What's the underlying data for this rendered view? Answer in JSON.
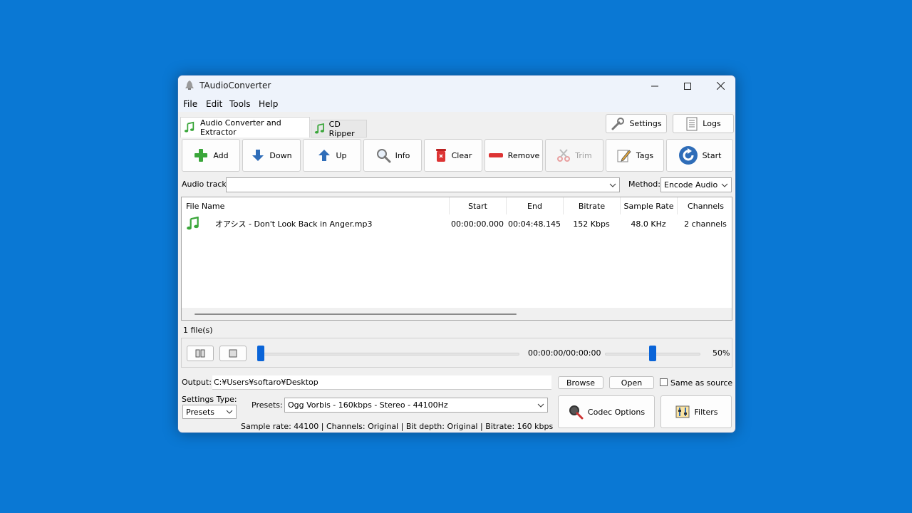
{
  "window": {
    "title": "TAudioConverter"
  },
  "menu": [
    "File",
    "Edit",
    "Tools",
    "Help"
  ],
  "tabs": [
    {
      "label": "Audio Converter and Extractor",
      "icon": "music-note-icon",
      "active": true
    },
    {
      "label": "CD Ripper",
      "icon": "music-note-icon",
      "active": false
    }
  ],
  "top_buttons": {
    "settings": "Settings",
    "logs": "Logs"
  },
  "toolbar": {
    "add": "Add",
    "down": "Down",
    "up": "Up",
    "info": "Info",
    "clear": "Clear",
    "remove": "Remove",
    "trim": "Trim",
    "tags": "Tags",
    "start": "Start"
  },
  "audio_track": {
    "label": "Audio track:",
    "value": ""
  },
  "method": {
    "label": "Method:",
    "value": "Encode Audio"
  },
  "file_list": {
    "columns": [
      "File Name",
      "Start",
      "End",
      "Bitrate",
      "Sample Rate",
      "Channels"
    ],
    "rows": [
      {
        "name": "オアシス - Don't Look Back in Anger.mp3",
        "start": "00:00:00.000",
        "end": "00:04:48.145",
        "bitrate": "152 Kbps",
        "sample_rate": "48.0 KHz",
        "channels": "2 channels"
      }
    ]
  },
  "file_count": "1 file(s)",
  "player": {
    "time": "00:00:00/00:00:00",
    "position": 0,
    "volume_percent": 50,
    "volume_label": "50%"
  },
  "output": {
    "label": "Output:",
    "path": "C:¥Users¥softaro¥Desktop",
    "browse": "Browse",
    "open": "Open",
    "same_as_source": "Same as source",
    "same_as_source_checked": false
  },
  "settings_type": {
    "label": "Settings Type:",
    "value": "Presets"
  },
  "presets": {
    "label": "Presets:",
    "value": "Ogg Vorbis - 160kbps - Stereo - 44100Hz"
  },
  "codec_options": "Codec Options",
  "filters": "Filters",
  "status": "Sample rate: 44100 | Channels: Original | Bit depth: Original | Bitrate: 160 kbps",
  "colors": {
    "desktop": "#0a78d4",
    "accent": "#0a64d8",
    "note_green": "#3aa63a"
  }
}
